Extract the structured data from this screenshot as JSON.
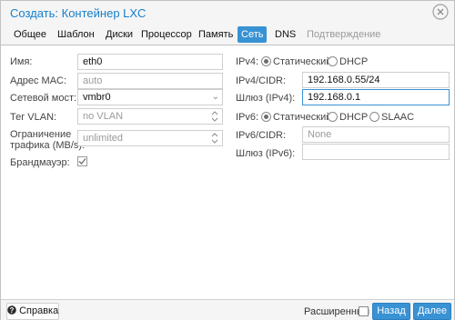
{
  "window": {
    "title": "Создать: Контейнер LXC"
  },
  "tabs": [
    {
      "label": "Общее"
    },
    {
      "label": "Шаблон"
    },
    {
      "label": "Диски"
    },
    {
      "label": "Процессор"
    },
    {
      "label": "Память"
    },
    {
      "label": "Сеть",
      "active": true
    },
    {
      "label": "DNS"
    },
    {
      "label": "Подтверждение",
      "disabled": true
    }
  ],
  "left_form": {
    "name": {
      "label": "Имя:",
      "value": "eth0"
    },
    "mac": {
      "label": "Адрес MAC:",
      "placeholder": "auto"
    },
    "bridge": {
      "label": "Сетевой мост:",
      "value": "vmbr0"
    },
    "vlan": {
      "label": "Тег VLAN:",
      "placeholder": "no VLAN"
    },
    "rate": {
      "label_line1": "Ограничение",
      "label_line2": "трафика (MB/s):",
      "placeholder": "unlimited"
    },
    "firewall": {
      "label": "Брандмауэр:",
      "checked": true
    }
  },
  "right_form": {
    "ipv4": {
      "label": "IPv4:",
      "options": [
        "Статический",
        "DHCP"
      ],
      "selected": "Статический"
    },
    "ipv4_cidr": {
      "label": "IPv4/CIDR:",
      "value": "192.168.0.55/24"
    },
    "gateway4": {
      "label": "Шлюз (IPv4):",
      "value": "192.168.0.1"
    },
    "ipv6": {
      "label": "IPv6:",
      "options": [
        "Статический",
        "DHCP",
        "SLAAC"
      ],
      "selected": "Статический"
    },
    "ipv6_cidr": {
      "label": "IPv6/CIDR:",
      "placeholder": "None"
    },
    "gateway6": {
      "label": "Шлюз (IPv6):",
      "value": ""
    }
  },
  "footer": {
    "help_label": "Справка",
    "advanced_label": "Расширенный",
    "advanced_checked": false,
    "back_label": "Назад",
    "next_label": "Далее"
  },
  "colors": {
    "accent": "#3892d4",
    "title": "#157fcc"
  }
}
